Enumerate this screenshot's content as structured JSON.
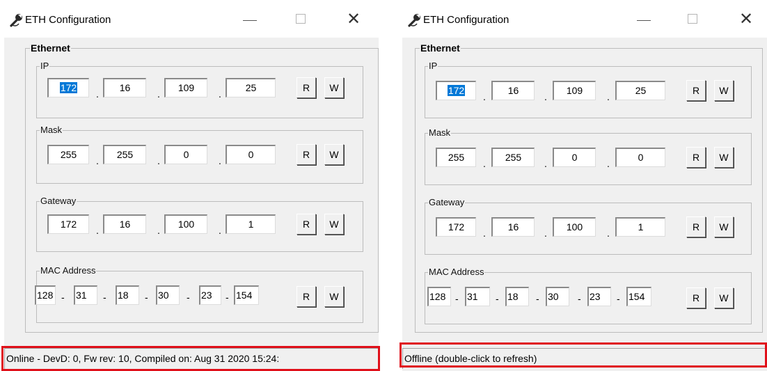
{
  "left": {
    "title": "ETH Configuration",
    "group_title": "Ethernet",
    "ip": {
      "label": "IP",
      "octets": [
        "172",
        "16",
        "109",
        "25"
      ]
    },
    "mask": {
      "label": "Mask",
      "octets": [
        "255",
        "255",
        "0",
        "0"
      ]
    },
    "gateway": {
      "label": "Gateway",
      "octets": [
        "172",
        "16",
        "100",
        "1"
      ]
    },
    "mac": {
      "label": "MAC Address",
      "bytes": [
        "128",
        "31",
        "18",
        "30",
        "23",
        "154"
      ]
    },
    "read_label": "R",
    "write_label": "W",
    "status": "Online - DevD: 0, Fw rev: 10, Compiled on: Aug 31 2020 15:24:"
  },
  "right": {
    "title": "ETH Configuration",
    "group_title": "Ethernet",
    "ip": {
      "label": "IP",
      "octets": [
        "172",
        "16",
        "109",
        "25"
      ]
    },
    "mask": {
      "label": "Mask",
      "octets": [
        "255",
        "255",
        "0",
        "0"
      ]
    },
    "gateway": {
      "label": "Gateway",
      "octets": [
        "172",
        "16",
        "100",
        "1"
      ]
    },
    "mac": {
      "label": "MAC Address",
      "bytes": [
        "128",
        "31",
        "18",
        "30",
        "23",
        "154"
      ]
    },
    "read_label": "R",
    "write_label": "W",
    "status": "Offline (double-click to refresh)"
  },
  "dot_separator": ".",
  "dash_separator": "-",
  "titlebar": {
    "minimize_glyph": "—",
    "close_glyph": "✕"
  },
  "icons": {
    "app": "wrench-icon"
  },
  "colors": {
    "highlight": "#e0101a",
    "selection": "#0078d7"
  }
}
